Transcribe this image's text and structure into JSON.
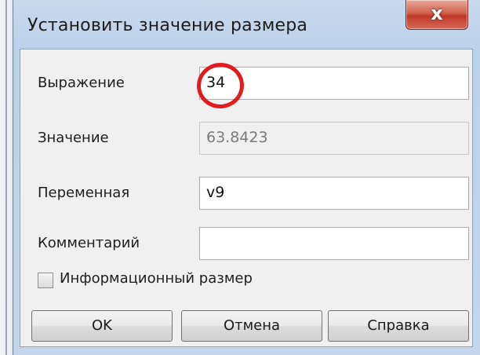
{
  "window": {
    "title": "Установить значение размера",
    "close_glyph": "x"
  },
  "form": {
    "expression": {
      "label": "Выражение",
      "value": "34"
    },
    "value": {
      "label": "Значение",
      "value": "63.8423"
    },
    "variable": {
      "label": "Переменная",
      "value": "v9"
    },
    "comment": {
      "label": "Комментарий",
      "value": ""
    }
  },
  "checkbox": {
    "label": "Информационный размер",
    "checked": false
  },
  "buttons": {
    "ok": "OK",
    "cancel": "Отмена",
    "help": "Справка"
  },
  "annotation": {
    "color": "#e21b1b"
  }
}
